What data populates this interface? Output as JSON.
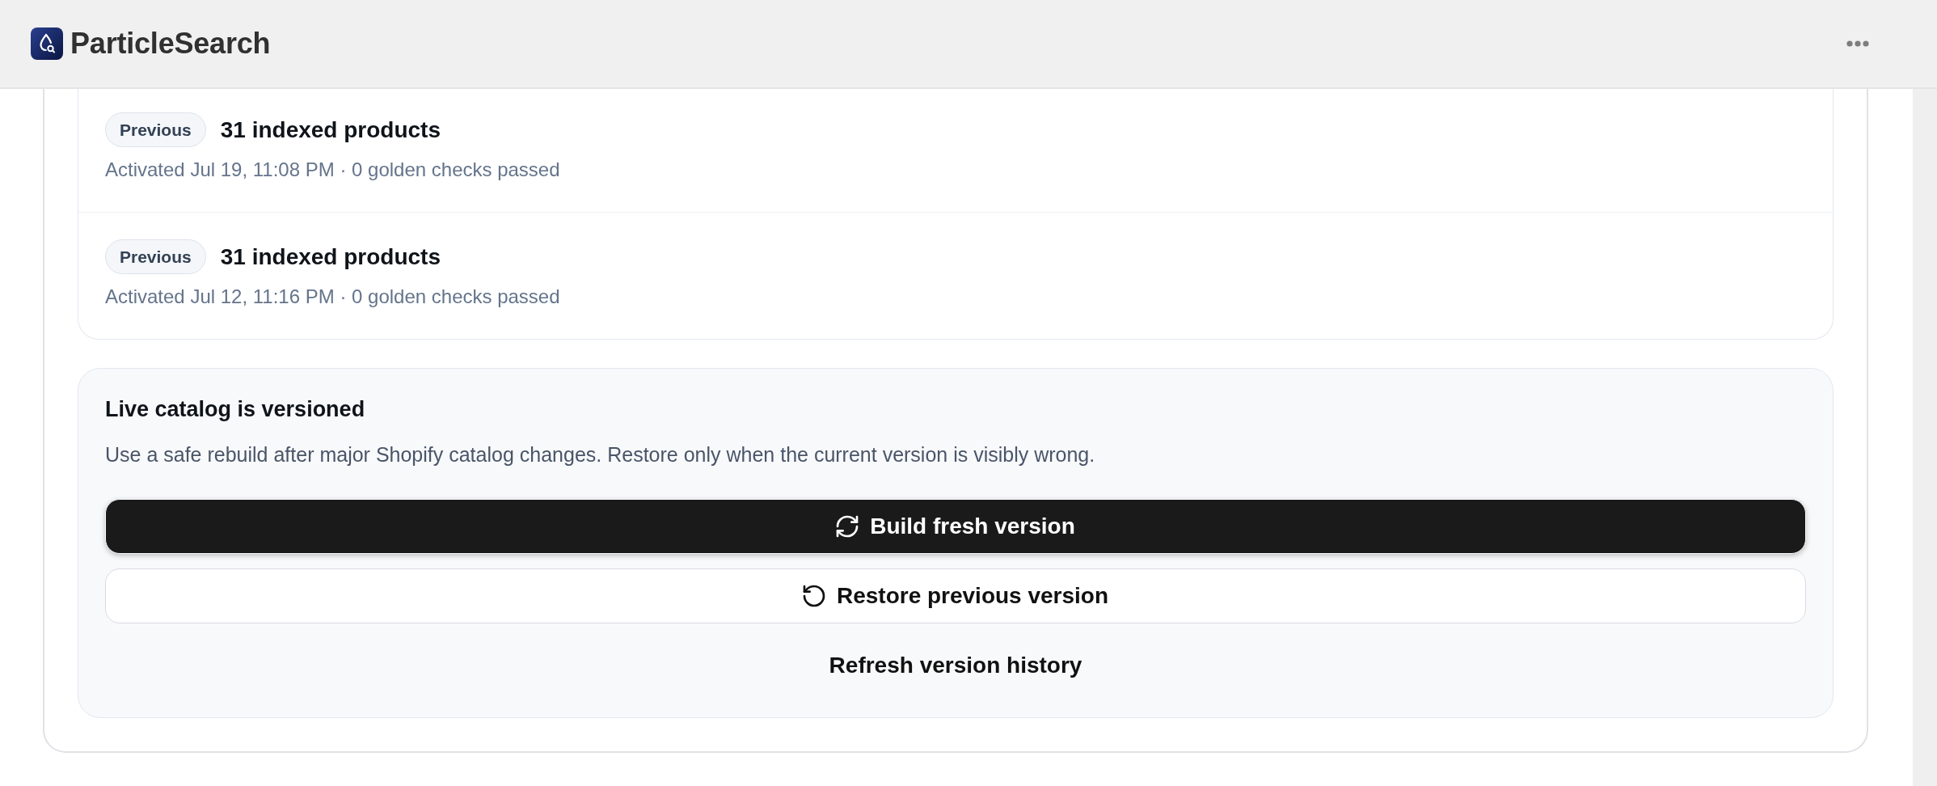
{
  "header": {
    "title": "ParticleSearch"
  },
  "versions": [
    {
      "badge": "Previous",
      "title": "31 indexed products",
      "meta": "Activated Jul 19, 11:08 PM · 0 golden checks passed"
    },
    {
      "badge": "Previous",
      "title": "31 indexed products",
      "meta": "Activated Jul 12, 11:16 PM · 0 golden checks passed"
    }
  ],
  "catalog_panel": {
    "title": "Live catalog is versioned",
    "description": "Use a safe rebuild after major Shopify catalog changes. Restore only when the current version is visibly wrong.",
    "actions": [
      {
        "label": "Build fresh version",
        "kind": "primary"
      },
      {
        "label": "Restore previous version",
        "kind": "secondary"
      },
      {
        "label": "Refresh version history",
        "kind": "plain"
      }
    ]
  }
}
